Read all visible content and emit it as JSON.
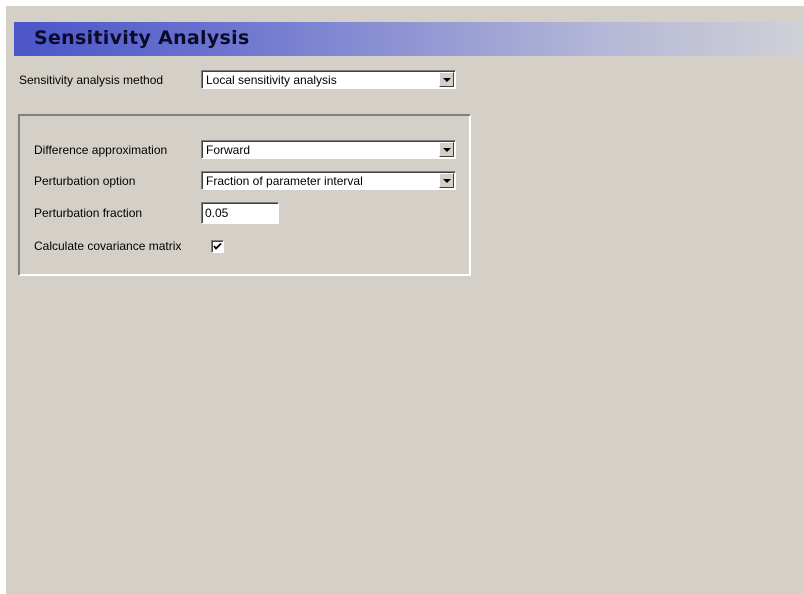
{
  "header": {
    "title": "Sensitivity Analysis"
  },
  "method": {
    "label": "Sensitivity analysis method",
    "value": "Local sensitivity analysis"
  },
  "options": {
    "difference_approximation": {
      "label": "Difference approximation",
      "value": "Forward"
    },
    "perturbation_option": {
      "label": "Perturbation option",
      "value": "Fraction of parameter interval"
    },
    "perturbation_fraction": {
      "label": "Perturbation fraction",
      "value": "0.05"
    },
    "covariance_matrix": {
      "label": "Calculate covariance matrix",
      "checked": true
    }
  },
  "colors": {
    "panel_background": "#d4d0c8",
    "header_gradient_start": "#4b55c8",
    "header_gradient_end": "#d0d0d6"
  },
  "icons": {
    "dropdown": "chevron-down-icon",
    "check": "checkmark-icon"
  }
}
